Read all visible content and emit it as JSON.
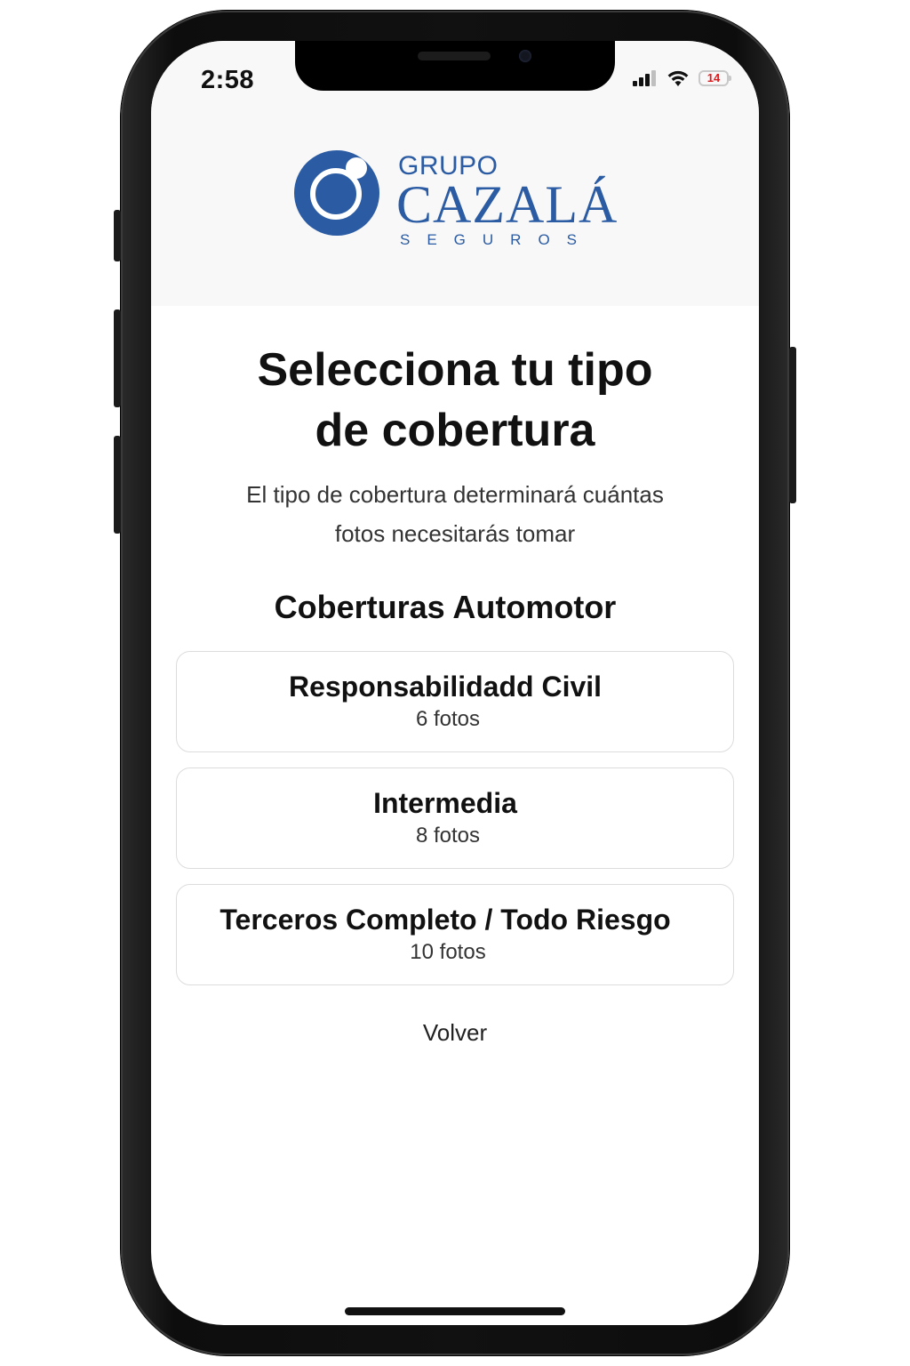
{
  "status_bar": {
    "time": "2:58",
    "battery_level": "14",
    "battery_color": "#e0191c"
  },
  "brand": {
    "line1": "GRUPO",
    "line2": "CAZALÁ",
    "line3": "SEGUROS",
    "color": "#2a5ba3"
  },
  "page": {
    "title_line1": "Selecciona tu tipo",
    "title_line2": "de cobertura",
    "subtitle_line1": "El tipo de cobertura determinará cuántas",
    "subtitle_line2": "fotos necesitarás tomar",
    "section_title": "Coberturas Automotor"
  },
  "options": [
    {
      "title": "Responsabilidadd Civil",
      "photos": "6 fotos"
    },
    {
      "title": "Intermedia",
      "photos": "8 fotos"
    },
    {
      "title": "Terceros Completo / Todo Riesgo",
      "photos": "10 fotos"
    }
  ],
  "back_label": "Volver"
}
